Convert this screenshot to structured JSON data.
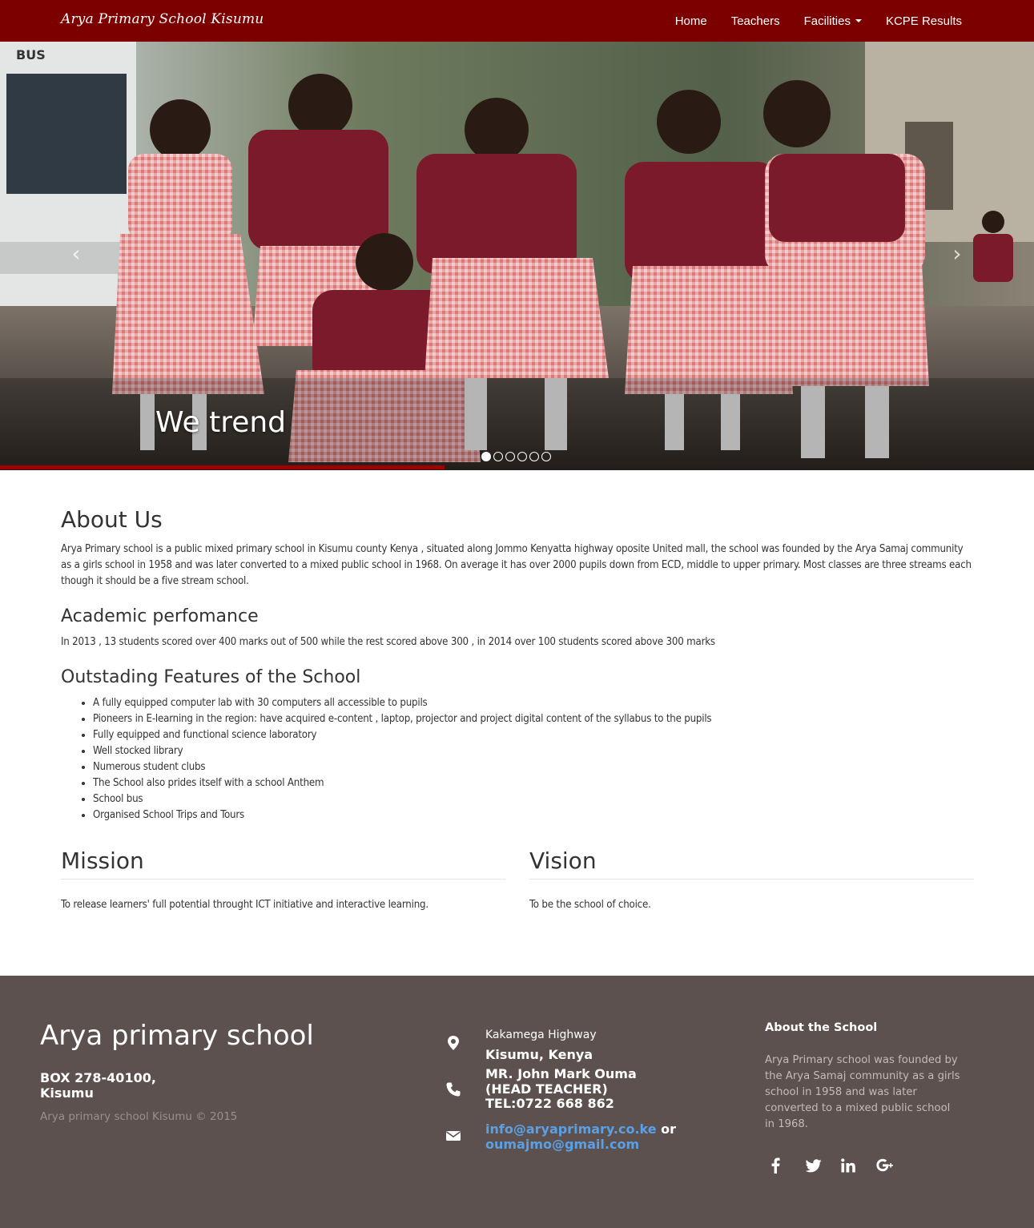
{
  "navbar": {
    "brand": "Arya Primary School Kisumu",
    "items": [
      {
        "label": "Home"
      },
      {
        "label": "Teachers"
      },
      {
        "label": "Facilities"
      },
      {
        "label": "KCPE Results"
      }
    ]
  },
  "carousel": {
    "caption": "We trend",
    "prev_icon": "chevron-left-icon",
    "next_icon": "chevron-right-icon",
    "indicator_count": 6,
    "active_index": 0,
    "progress_fraction": 0.43
  },
  "about": {
    "title": "About Us",
    "text": "Arya Primary school is a public mixed primary school in Kisumu county Kenya , situated along Jommo Kenyatta highway oposite United mall, the school was founded by the Arya Samaj community as a girls school in 1958 and was later converted to a mixed public school in 1968. On average it has over 2000 pupils down from ECD, middle to upper primary. Most classes are three streams each though it should be a five stream school."
  },
  "academic": {
    "title": "Academic perfomance",
    "text": "In 2013 , 13 students scored over 400 marks out of 500 while the rest scored above 300 , in 2014 over 100 students scored above 300 marks"
  },
  "features": {
    "title": "Outstading Features of the School",
    "items": [
      "A fully equipped computer lab with 30 computers all accessible to pupils",
      "Pioneers in E-learning in the region: have acquired e-content , laptop, projector and project digital content of the syllabus to the pupils",
      "Fully equipped and functional science laboratory",
      "Well stocked library",
      "Numerous student clubs",
      "The School also prides itself with a school Anthem",
      "School bus",
      "Organised School Trips and Tours"
    ]
  },
  "mission": {
    "title": "Mission",
    "text": "To release learners' full potential throught ICT initiative and interactive learning."
  },
  "vision": {
    "title": "Vision",
    "text": "To be the school of choice."
  },
  "footer": {
    "school_name": "Arya primary school",
    "box_line1": "BOX 278-40100,",
    "box_line2": "Kisumu",
    "copyright": "Arya primary school Kisumu © 2015",
    "address_line1": "Kakamega Highway",
    "address_line2": "Kisumu, Kenya",
    "contact_line1": "MR. John Mark Ouma",
    "contact_line2": "(HEAD TEACHER)",
    "contact_line3": "TEL:0722 668 862",
    "email1": "info@aryaprimary.co.ke",
    "email_or": "or",
    "email2": "oumajmo@gmail.com",
    "about_heading": "About the School",
    "about_text": "Arya Primary school was founded by the Arya Samaj community as a girls school in 1958 and was later converted to a mixed public school in 1968.",
    "icons": [
      "map-marker-icon",
      "phone-icon",
      "envelope-icon"
    ],
    "social": [
      {
        "name": "facebook-icon",
        "glyph": "f"
      },
      {
        "name": "twitter-icon",
        "glyph": "t"
      },
      {
        "name": "linkedin-icon",
        "glyph": "in"
      },
      {
        "name": "google-plus-icon",
        "glyph": "g+"
      }
    ]
  },
  "colors": {
    "navbar": "#7d0000",
    "footer": "#5c514e",
    "link": "#5aa0e6",
    "progress": "#a00000"
  }
}
